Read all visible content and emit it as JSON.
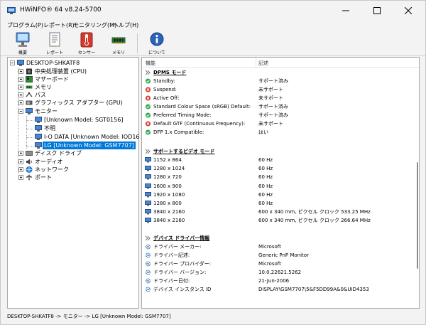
{
  "window": {
    "title": "HWiNFO® 64 v8.24-5700",
    "accent": "#0078d7"
  },
  "menu": [
    {
      "label": "プログラム(P)"
    },
    {
      "label": "レポート(R)"
    },
    {
      "label": "モニタリング(M)"
    },
    {
      "label": "ヘルプ(H)"
    }
  ],
  "toolbar": [
    {
      "label": "概要",
      "icon": "computer-icon"
    },
    {
      "label": "レポート",
      "icon": "report-icon"
    },
    {
      "label": "センサー",
      "icon": "thermometer-icon"
    },
    {
      "label": "メモリ",
      "icon": "memory-icon"
    },
    {
      "label": "について",
      "icon": "info-icon"
    }
  ],
  "tree": {
    "root": "DESKTOP-SHKATF8",
    "cpu": "中央処理装置 (CPU)",
    "motherboard": "マザーボード",
    "memory": "メモリ",
    "bus": "バス",
    "gpu": "グラフィックス アダプター (GPU)",
    "monitor": "モニター",
    "monitor_children": [
      "[Unknown Model: SGT0156]",
      "不明",
      "I-O DATA [Unknown Model: IOD160B]",
      "LG [Unknown Model: GSM7707]"
    ],
    "disk": "ディスク ドライブ",
    "audio": "オーディオ",
    "network": "ネットワーク",
    "port": "ポート"
  },
  "detail": {
    "col_feature": "機能",
    "col_desc": "記述",
    "dpms": {
      "title": "DPMS モード",
      "rows": [
        {
          "k": "Standby:",
          "v": "サポート済み",
          "status": "ok"
        },
        {
          "k": "Suspend:",
          "v": "未サポート",
          "status": "no"
        },
        {
          "k": "Active Off:",
          "v": "未サポート",
          "status": "no"
        },
        {
          "k": "Standard Colour Space (sRGB) Default:",
          "v": "サポート済み",
          "status": "ok"
        },
        {
          "k": "Preferred Timing Mode:",
          "v": "サポート済み",
          "status": "ok"
        },
        {
          "k": "Default GTF (Continuous Frequency):",
          "v": "未サポート",
          "status": "no"
        },
        {
          "k": "DFP 1.x Compatible:",
          "v": "はい",
          "status": "ok"
        }
      ]
    },
    "video": {
      "title": "サポートするビデオ モード",
      "rows": [
        {
          "k": "1152 x 864",
          "v": "60 Hz"
        },
        {
          "k": "1280 x 1024",
          "v": "60 Hz"
        },
        {
          "k": "1280 x 720",
          "v": "60 Hz"
        },
        {
          "k": "1600 x 900",
          "v": "60 Hz"
        },
        {
          "k": "1920 x 1080",
          "v": "60 Hz"
        },
        {
          "k": "1280 x 800",
          "v": "60 Hz"
        },
        {
          "k": "3840 x 2160",
          "v": "600 x 340 mm, ピクセル クロック 533.25 MHz"
        },
        {
          "k": "3840 x 2160",
          "v": "600 x 340 mm, ピクセル クロック 266.64 MHz"
        }
      ]
    },
    "driver": {
      "title": "デバイス ドライバー情報",
      "rows": [
        {
          "k": "ドライバー メーカー:",
          "v": "Microsoft"
        },
        {
          "k": "ドライバー記述:",
          "v": "Generic PnP Monitor"
        },
        {
          "k": "ドライバー プロバイダー:",
          "v": "Microsoft"
        },
        {
          "k": "ドライバー バージョン:",
          "v": "10.0.22621.5262"
        },
        {
          "k": "ドライバー日付:",
          "v": "21-Jun-2006"
        },
        {
          "k": "デバイス インスタンス ID",
          "v": "DISPLAY\\GSM7707\\5&F5DD99A&0&UID4353"
        }
      ]
    }
  },
  "status_bar": "DESKTOP-SHKATF8 -> モニター -> LG [Unknown Model: GSM7707]"
}
